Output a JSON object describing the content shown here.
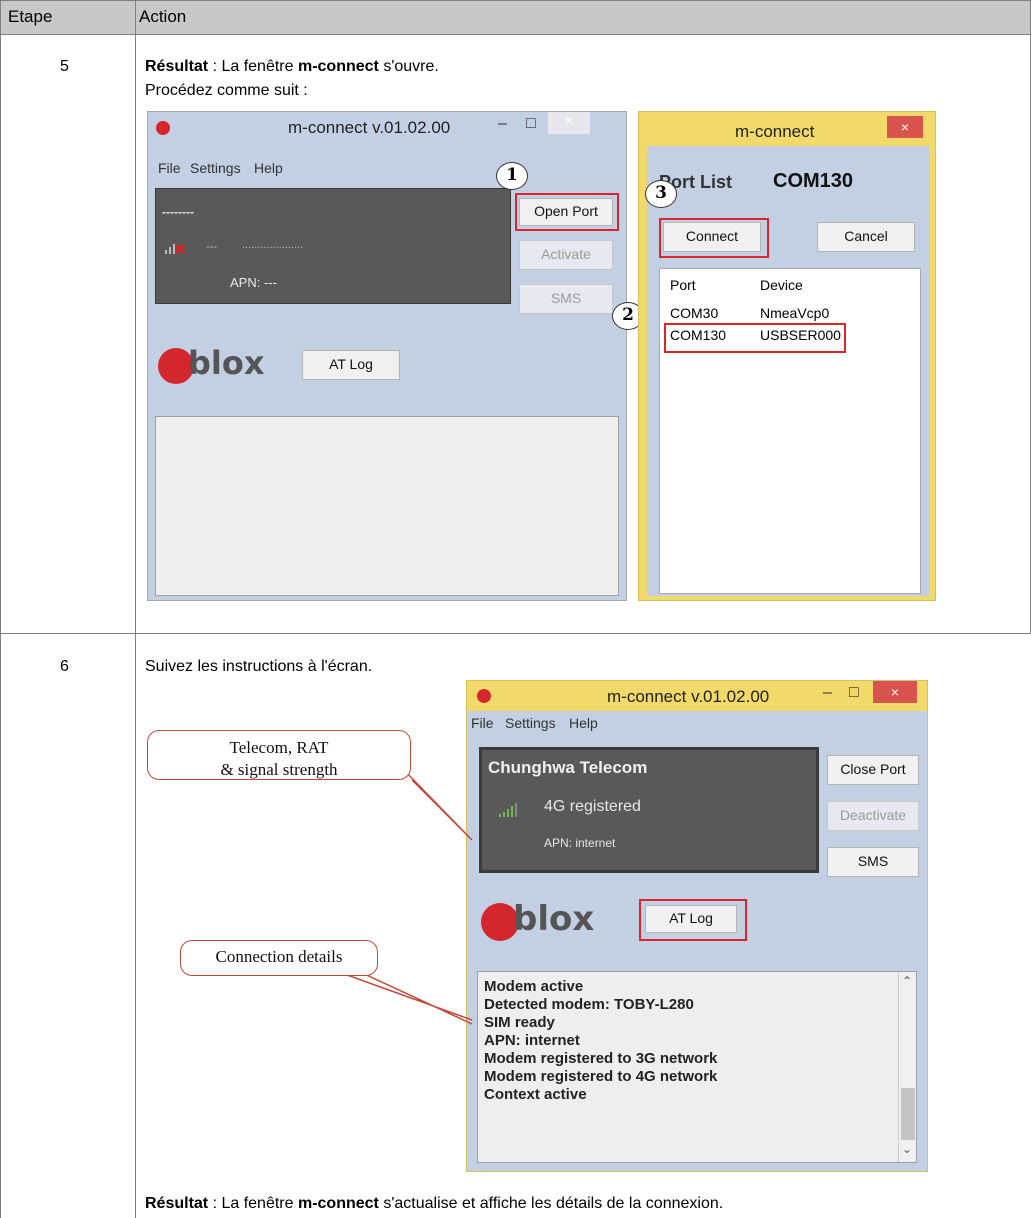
{
  "table": {
    "headers": [
      "Etape",
      "Action"
    ],
    "rows": [
      {
        "step": "5",
        "result_label": "Résultat",
        "result_text_1": " : La fenêtre ",
        "result_app": "m-connect",
        "result_text_2": " s'ouvre.",
        "instruction": "Procédez comme suit :"
      },
      {
        "step": "6",
        "instruction": "Suivez les instructions à l'écran.",
        "result_label": "Résultat",
        "result_text_1": " : La fenêtre ",
        "result_app": "m-connect",
        "result_text_2": " s'actualise et affiche les détails de la connexion."
      }
    ]
  },
  "screen1": {
    "title": "m-connect v.01.02.00",
    "menu": [
      "File",
      "Settings",
      "Help"
    ],
    "panel": {
      "operator": "--------",
      "status": "---",
      "status_dots": "....................",
      "apn": "APN: ---"
    },
    "buttons": {
      "open_port": "Open Port",
      "activate": "Activate",
      "sms": "SMS",
      "at_log": "AT Log"
    },
    "logo_text": "blox",
    "callouts": [
      "1",
      "2",
      "3"
    ]
  },
  "dialog": {
    "title": "m-connect",
    "close": "×",
    "port_list_label": "Port List",
    "selected_port": "COM130",
    "connect": "Connect",
    "cancel": "Cancel",
    "columns": [
      "Port",
      "Device"
    ],
    "ports": [
      {
        "port": "COM30",
        "device": "NmeaVcp0"
      },
      {
        "port": "COM130",
        "device": "USBSER000"
      }
    ]
  },
  "screen2": {
    "title": "m-connect v.01.02.00",
    "menu": [
      "File",
      "Settings",
      "Help"
    ],
    "panel": {
      "operator": "Chunghwa Telecom",
      "status": "4G registered",
      "apn": "APN: internet"
    },
    "buttons": {
      "close_port": "Close Port",
      "deactivate": "Deactivate",
      "sms": "SMS",
      "at_log": "AT Log"
    },
    "logo_text": "blox",
    "log": [
      "Modem active",
      "Detected modem: TOBY-L280",
      "SIM ready",
      "APN: internet",
      "Modem registered to 3G network",
      "Modem registered to 4G network",
      "Context active"
    ],
    "bubbles": {
      "telecom": [
        "Telecom, RAT",
        "& signal strength"
      ],
      "connection": "Connection details"
    }
  },
  "colors": {
    "header_bg": "#c8c8c8",
    "highlight": "#d8262a",
    "dialog_border": "#f1d96a"
  }
}
